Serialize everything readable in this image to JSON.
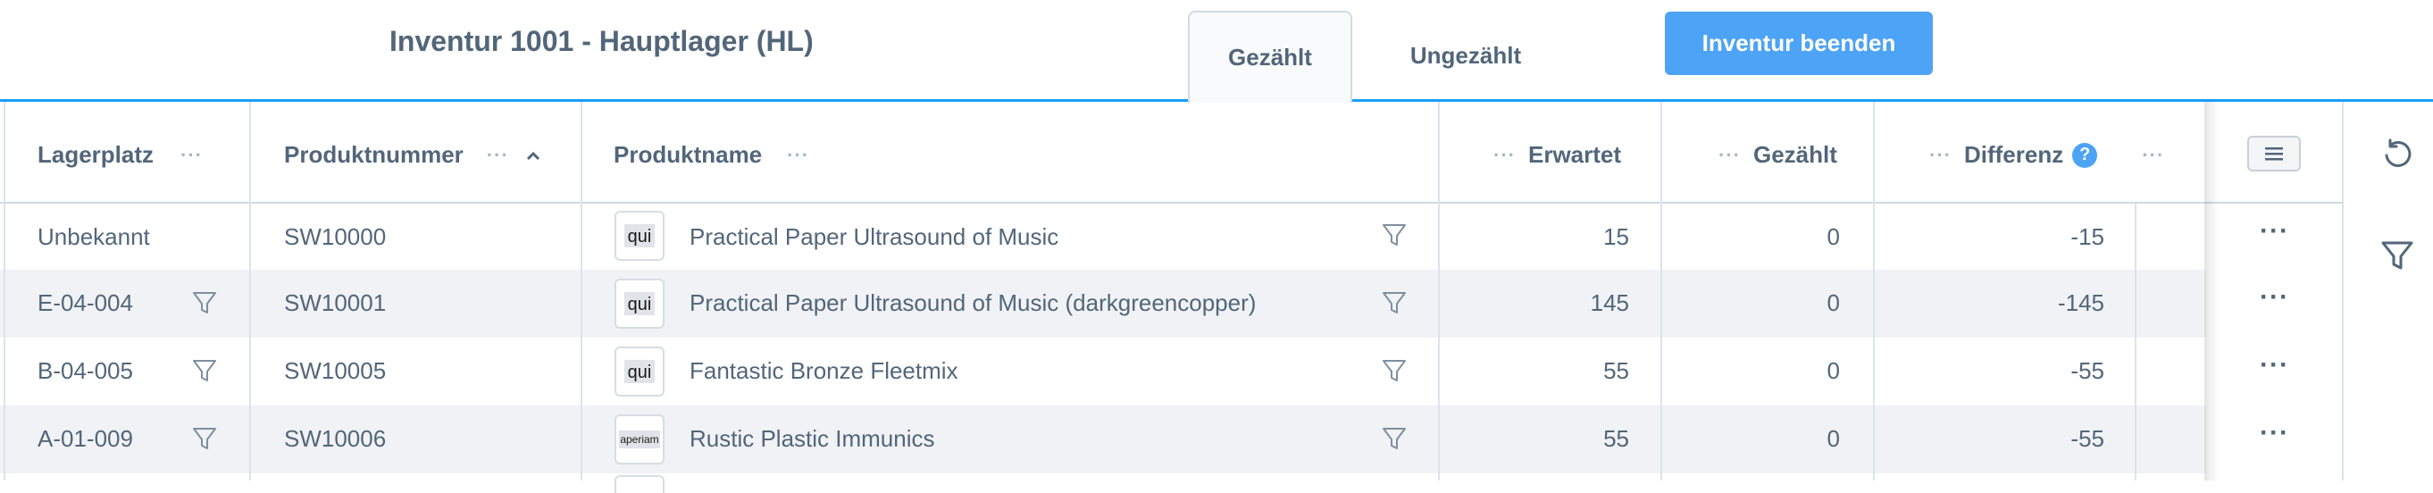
{
  "header": {
    "title": "Inventur 1001 - Hauptlager (HL)",
    "tabs": [
      {
        "label": "Gezählt",
        "active": true
      },
      {
        "label": "Ungezählt",
        "active": false
      }
    ],
    "finish_button": "Inventur beenden",
    "accent_color": "#189eff",
    "button_color": "#4da3f5"
  },
  "table": {
    "columns": {
      "lagerplatz": "Lagerplatz",
      "produktnummer": "Produktnummer",
      "produktname": "Produktname",
      "erwartet": "Erwartet",
      "gezaehlt": "Gezählt",
      "differenz": "Differenz",
      "help_glyph": "?",
      "menu_dots": "···"
    },
    "rows": [
      {
        "lagerplatz": "Unbekannt",
        "produktnummer": "SW10000",
        "thumb": "qui",
        "produktname": "Practical Paper Ultrasound of Music",
        "erwartet": "15",
        "gezaehlt": "0",
        "differenz": "-15",
        "row_menu": "···"
      },
      {
        "lagerplatz": "E-04-004",
        "produktnummer": "SW10001",
        "thumb": "qui",
        "produktname": "Practical Paper Ultrasound of Music (darkgreencopper)",
        "erwartet": "145",
        "gezaehlt": "0",
        "differenz": "-145",
        "row_menu": "···"
      },
      {
        "lagerplatz": "B-04-005",
        "produktnummer": "SW10005",
        "thumb": "qui",
        "produktname": "Fantastic Bronze Fleetmix",
        "erwartet": "55",
        "gezaehlt": "0",
        "differenz": "-55",
        "row_menu": "···"
      },
      {
        "lagerplatz": "A-01-009",
        "produktnummer": "SW10006",
        "thumb": "aperiam",
        "produktname": "Rustic Plastic Immunics",
        "erwartet": "55",
        "gezaehlt": "0",
        "differenz": "-55",
        "row_menu": "···"
      }
    ]
  },
  "sidebar": {
    "icons": [
      "refresh-icon",
      "filter-icon"
    ]
  }
}
